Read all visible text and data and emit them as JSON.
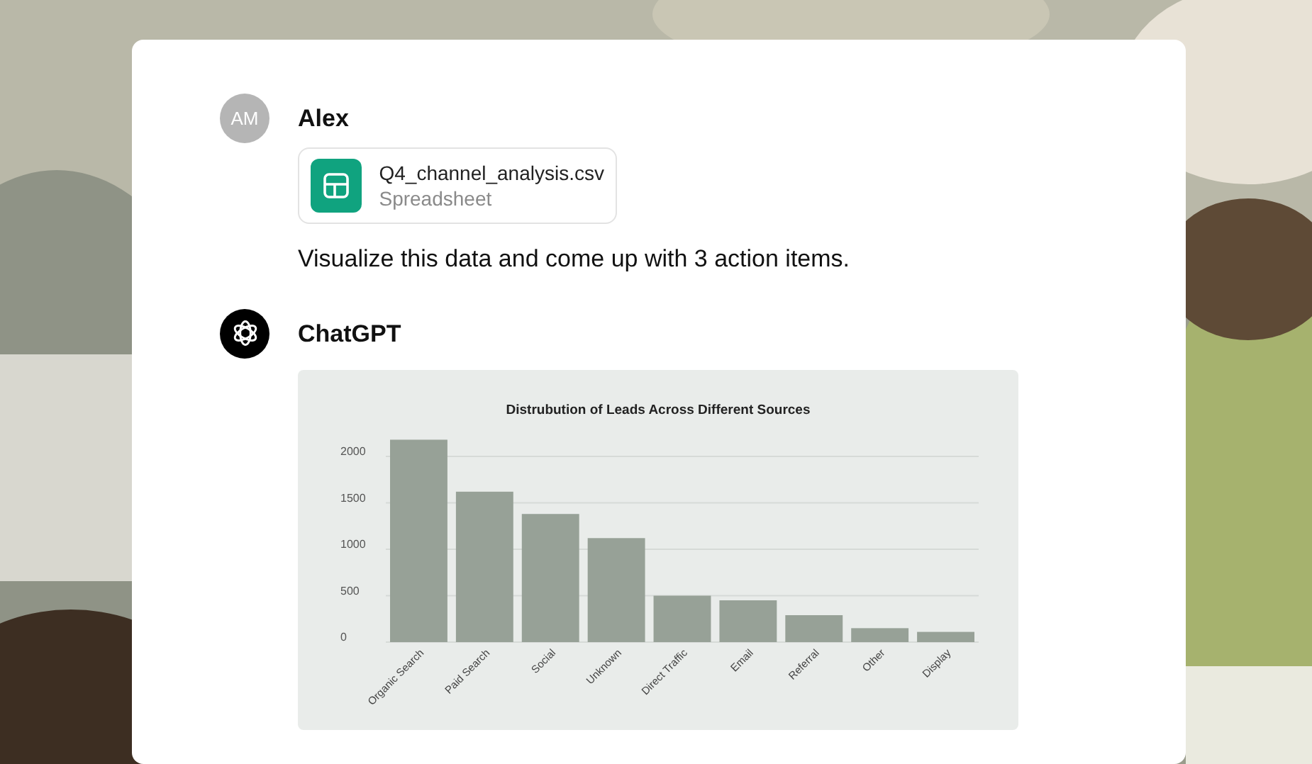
{
  "messages": [
    {
      "author": "Alex",
      "avatar": {
        "kind": "initials",
        "text": "AM"
      },
      "attachment": {
        "name": "Q4_channel_analysis.csv",
        "type": "Spreadsheet"
      },
      "text": "Visualize this data and come up with 3 action items."
    },
    {
      "author": "ChatGPT",
      "avatar": {
        "kind": "logo"
      },
      "chart_data": {
        "type": "bar",
        "title": "Distrubution of Leads Across Different Sources",
        "categories": [
          "Organic Search",
          "Paid Search",
          "Social",
          "Unknown",
          "Direct Traffic",
          "Email",
          "Referral",
          "Other",
          "Display"
        ],
        "series": [
          {
            "color": "#97a197",
            "values": [
              2180,
              1620,
              1380,
              1120,
              500,
              450,
              290,
              150,
              110
            ]
          }
        ],
        "yticks": [
          0,
          500,
          1000,
          1500,
          2000
        ],
        "ylim": [
          0,
          2200
        ],
        "grid": true
      }
    }
  ]
}
